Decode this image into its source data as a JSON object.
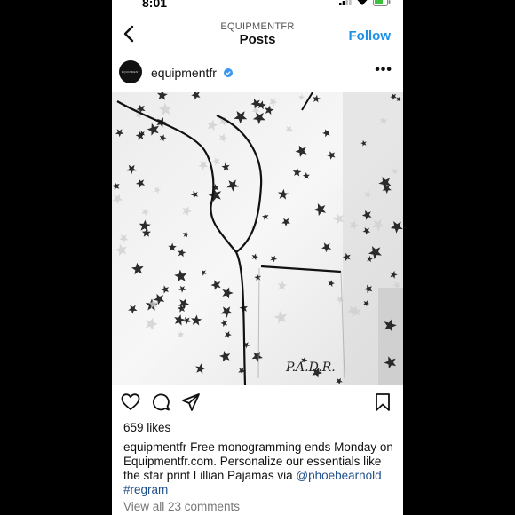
{
  "status_bar": {
    "time": "8:01"
  },
  "header": {
    "account": "EQUIPMENTFR",
    "title": "Posts",
    "follow_label": "Follow"
  },
  "post": {
    "avatar_text": "EQUIPMENT",
    "username": "equipmentfr",
    "image_monogram": "P.A.D.R.",
    "likes": "659 likes",
    "caption": {
      "user": "equipmentfr",
      "text": "Free monogramming ends Monday on Equipmentfr.com. Personalize our essentials like the star print Lillian Pajamas via",
      "mention": "@phoebearnold",
      "hashtag": "#regram"
    },
    "view_comments": "View all 23 comments"
  },
  "colors": {
    "accent": "#1e90e6",
    "link": "#1f4f8a"
  },
  "icons": [
    "back-arrow-icon",
    "more-icon",
    "verified-icon",
    "heart-icon",
    "comment-icon",
    "share-icon",
    "bookmark-icon"
  ]
}
